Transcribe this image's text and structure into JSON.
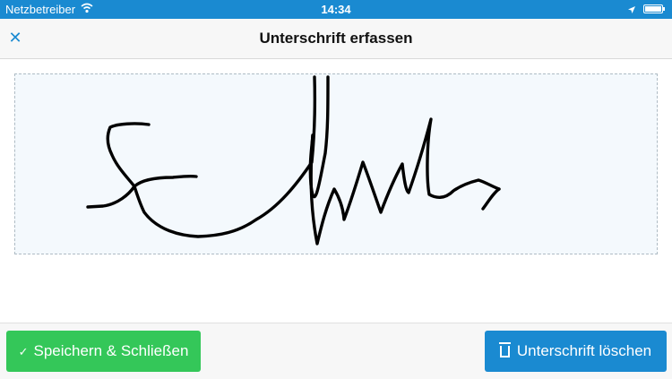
{
  "status_bar": {
    "carrier": "Netzbetreiber",
    "time": "14:34"
  },
  "nav": {
    "title": "Unterschrift erfassen"
  },
  "footer": {
    "save_label": "Speichern & Schließen",
    "clear_label": "Unterschrift löschen"
  },
  "colors": {
    "accent": "#1a8ad1",
    "save_button": "#34c759",
    "signature_pad_bg": "#f4f9fd"
  },
  "icons": [
    "wifi-icon",
    "location-arrow-icon",
    "battery-icon",
    "close-icon",
    "check-icon",
    "trash-icon"
  ]
}
